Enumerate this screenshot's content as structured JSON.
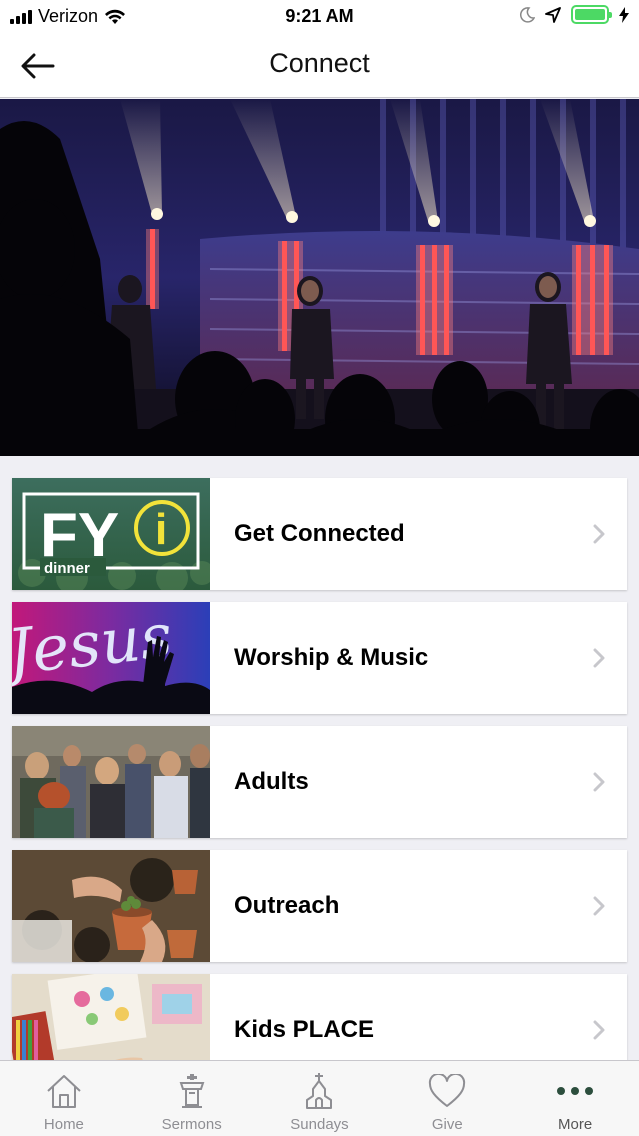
{
  "status_bar": {
    "carrier": "Verizon",
    "time": "9:21 AM",
    "battery_color": "#4cd964"
  },
  "nav": {
    "title": "Connect",
    "back_icon": "arrow-left-icon"
  },
  "list": {
    "items": [
      {
        "label": "Get Connected",
        "thumb": "fyi-dinner-logo",
        "thumb_text_main": "FY",
        "thumb_text_i": "i",
        "thumb_text_sub": "dinner"
      },
      {
        "label": "Worship & Music",
        "thumb": "jesus-neon-worship-photo",
        "thumb_text_main": "Jesus"
      },
      {
        "label": "Adults",
        "thumb": "adults-crowd-photo"
      },
      {
        "label": "Outreach",
        "thumb": "planting-pots-photo"
      },
      {
        "label": "Kids PLACE",
        "thumb": "kids-coloring-photo"
      }
    ]
  },
  "tab_bar": {
    "tabs": [
      {
        "label": "Home",
        "icon": "house-icon"
      },
      {
        "label": "Sermons",
        "icon": "podium-icon"
      },
      {
        "label": "Sundays",
        "icon": "church-icon"
      },
      {
        "label": "Give",
        "icon": "heart-icon"
      },
      {
        "label": "More",
        "icon": "more-dots-icon",
        "active": true
      }
    ]
  },
  "colors": {
    "accent": "#2c4e3d",
    "background": "#efeff4",
    "tab_inactive": "#8e8e93"
  }
}
